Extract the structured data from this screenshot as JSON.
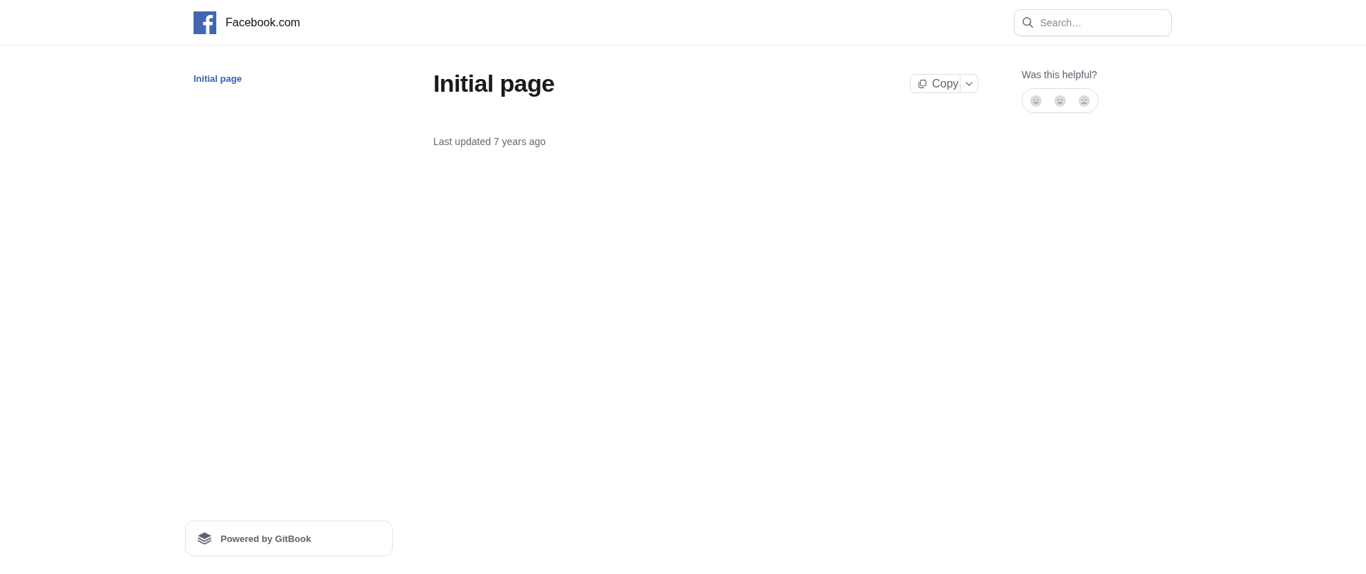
{
  "header": {
    "site_title": "Facebook.com",
    "search": {
      "placeholder": "Search…"
    }
  },
  "sidebar": {
    "items": [
      {
        "label": "Initial page",
        "selected": true
      }
    ],
    "footer_link": "Powered by GitBook"
  },
  "page": {
    "title": "Initial page",
    "copy_button": "Copy",
    "last_updated": "Last updated 7 years ago"
  },
  "feedback": {
    "question": "Was this helpful?",
    "options": [
      {
        "kind": "happy",
        "selected": false
      },
      {
        "kind": "neutral",
        "selected": false
      },
      {
        "kind": "sad",
        "selected": false
      }
    ]
  }
}
